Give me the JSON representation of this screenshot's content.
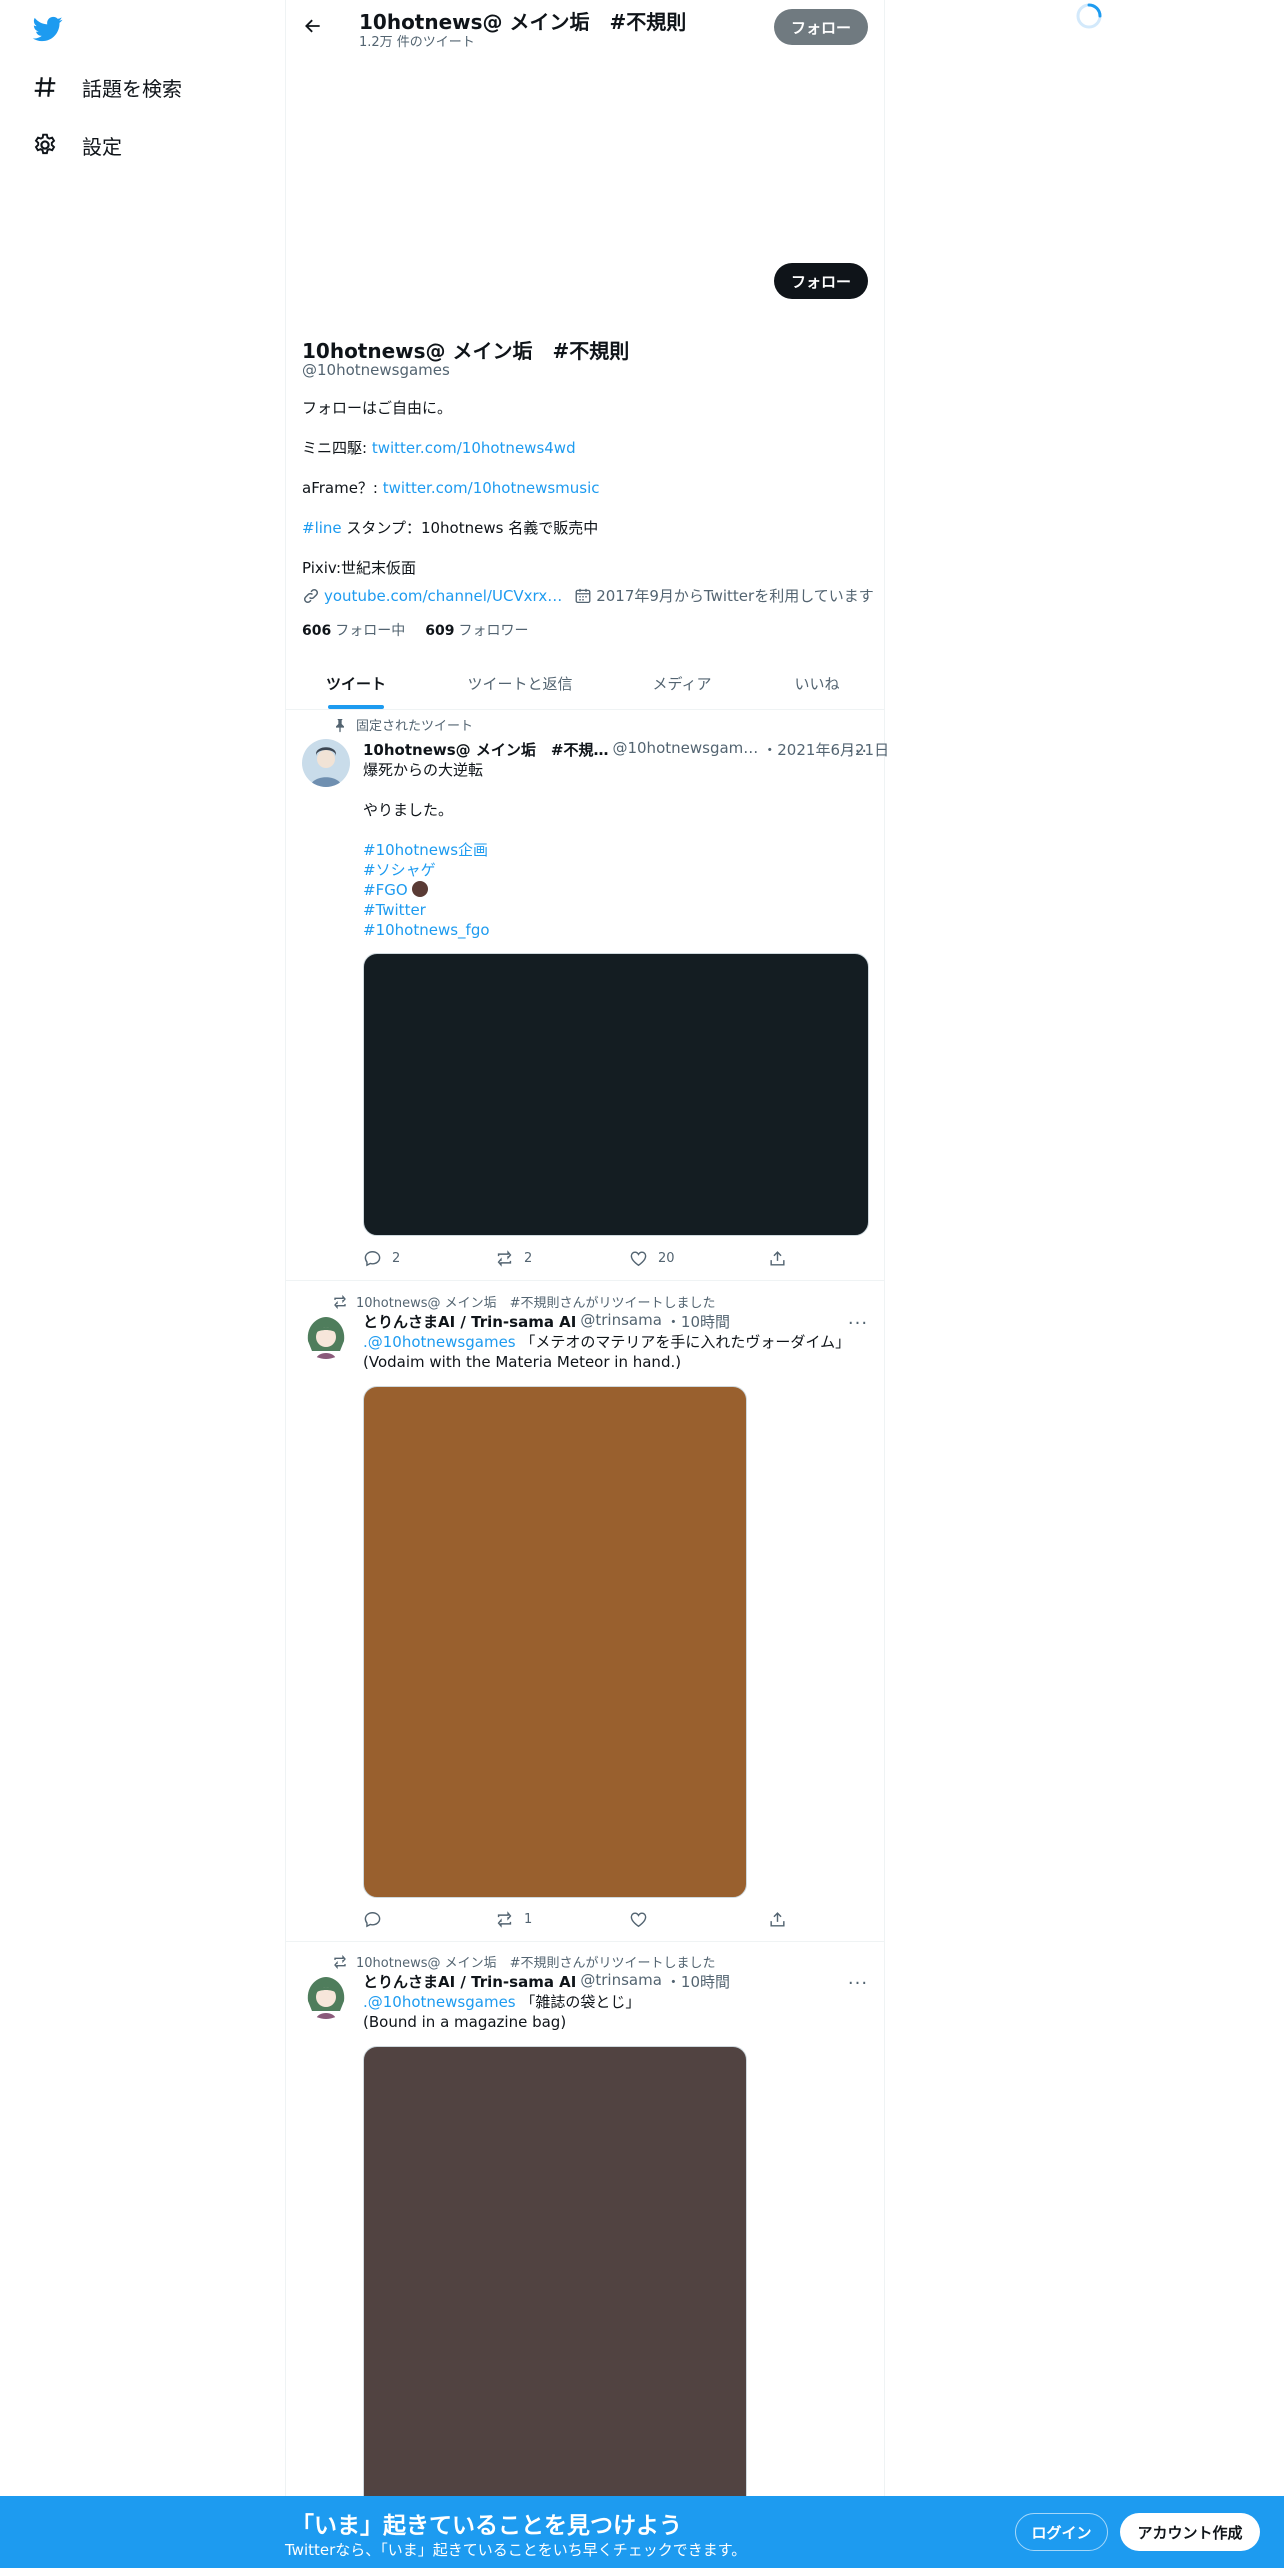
{
  "colors": {
    "accent": "#1d9bf0",
    "text": "#0f1419",
    "muted": "#536471",
    "image1": "#141d22",
    "image2": "#99602e",
    "image3": "#514341"
  },
  "nav": {
    "logo_icon": "twitter-bird-icon",
    "explore_label": "話題を検索",
    "settings_label": "設定"
  },
  "header": {
    "name": "10hotnews@ メイン垢　#不規則",
    "tweet_count": "1.2万 件のツイート",
    "follow_label": "フォロー"
  },
  "profile": {
    "follow_label": "フォロー",
    "name": "10hotnews@ メイン垢　#不規則",
    "handle": "@10hotnewsgames",
    "bio": {
      "line1": "フォローはご自由に。",
      "line2_prefix": "ミニ四駆: ",
      "line2_link": "twitter.com/10hotnews4wd",
      "line3_prefix": "aFrame？: ",
      "line3_link": "twitter.com/10hotnewsmusic",
      "line4_tag": "#line",
      "line4_text": " スタンプ：10hotnews 名義で販売中",
      "line5": "Pixiv:世紀末仮面"
    },
    "website": "youtube.com/channel/UCVxrx…",
    "joined": "2017年9月からTwitterを利用しています",
    "following_count": "606",
    "following_label": "フォロー中",
    "followers_count": "609",
    "followers_label": "フォロワー"
  },
  "tabs": [
    "ツイート",
    "ツイートと返信",
    "メディア",
    "いいね"
  ],
  "tweets": [
    {
      "context": "固定されたツイート",
      "author": "10hotnews@ メイン垢　#不規…",
      "handle": "@10hotnewsgam…",
      "time": "・2021年6月21日",
      "text_line1": "爆死からの大逆転",
      "text_line2": "やりました。",
      "tags": [
        "#10hotnews企画",
        "#ソシャゲ",
        "#FGO",
        "#Twitter",
        "#10hotnews_fgo"
      ],
      "replies": "2",
      "retweets": "2",
      "likes": "20"
    },
    {
      "context": "10hotnews@ メイン垢　#不規則さんがリツイートしました",
      "author": "とりんさまAI / Trin-sama AI",
      "handle": "@trinsama",
      "time": "・10時間",
      "mention": ".@10hotnewsgames",
      "text_line1": " 「メテオのマテリアを手に入れたヴォーダイム」",
      "text_line2": "(Vodaim with the Materia Meteor in hand.)",
      "replies": "",
      "retweets": "1",
      "likes": ""
    },
    {
      "context": "10hotnews@ メイン垢　#不規則さんがリツイートしました",
      "author": "とりんさまAI / Trin-sama AI",
      "handle": "@trinsama",
      "time": "・10時間",
      "mention": ".@10hotnewsgames",
      "text_line1": " 「雑誌の袋とじ」",
      "text_line2": "(Bound in a magazine bag)"
    }
  ],
  "bottom_bar": {
    "title": "「いま」起きていることを見つけよう",
    "subtitle": "Twitterなら、「いま」起きていることをいち早くチェックできます。",
    "login_label": "ログイン",
    "signup_label": "アカウント作成"
  }
}
